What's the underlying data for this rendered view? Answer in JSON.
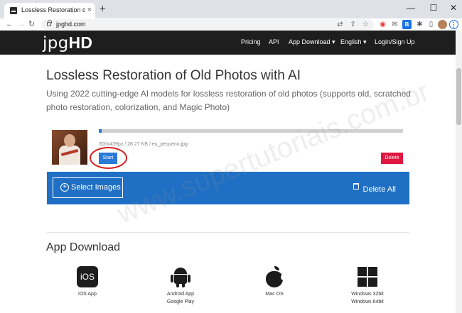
{
  "browser": {
    "tab_title": "Lossless Restoration of Old Photos",
    "tab_close": "×",
    "new_tab": "+",
    "url": "jpghd.com",
    "window": {
      "minimize": "—",
      "maximize": "☐",
      "close": "✕"
    },
    "nav": {
      "back": "←",
      "forward": "→",
      "reload": "↻"
    }
  },
  "site": {
    "logo_part1": "jpg",
    "logo_part2": "HD",
    "nav": [
      "Pricing",
      "API",
      "App Download ▾",
      "English ▾",
      "Login/Sign Up"
    ]
  },
  "hero": {
    "title": "Lossless Restoration of Old Photos with AI",
    "subtitle": "Using 2022 cutting-edge AI models for lossless restoration of old photos (supports old, scratched photo restoration, colorization, and Magic Photo)"
  },
  "upload": {
    "file_info": "300x439px / 28.27 KB / eu_pequeno.jpg",
    "progress": 0.01,
    "start_label": "Start",
    "delete_label": "Delete"
  },
  "actions": {
    "select_images": "Select Images",
    "delete_all": "Delete All"
  },
  "app_download": {
    "title": "App Download",
    "apps": [
      {
        "icon": "ios-icon",
        "icon_text": "iOS",
        "lines": [
          "iOS App"
        ]
      },
      {
        "icon": "android-icon",
        "lines": [
          "Android App",
          "Google Play"
        ]
      },
      {
        "icon": "apple-icon",
        "lines": [
          "Mac OS"
        ]
      },
      {
        "icon": "windows-icon",
        "lines": [
          "Windows 32bit",
          "Windows 64bit"
        ]
      }
    ]
  },
  "watermark": "www.supertutoriais.com.br",
  "colors": {
    "nav_bg": "#1e1e1e",
    "accent_blue": "#1f6fc4",
    "start_blue": "#2a7ad8",
    "delete_red": "#e0173f",
    "annotation_red": "#d81e1e"
  }
}
